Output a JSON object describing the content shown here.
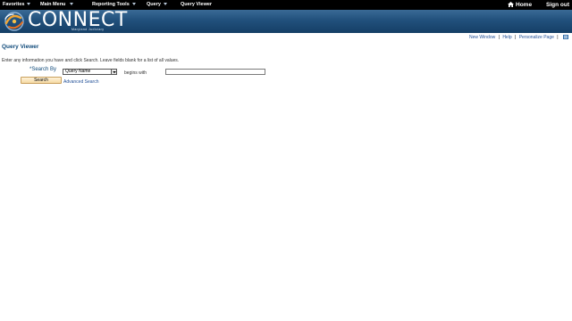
{
  "nav": {
    "items": [
      {
        "label": "Favorites",
        "has_dropdown": true
      },
      {
        "label": "Main Menu",
        "has_dropdown": true
      },
      {
        "label": "Reporting Tools",
        "has_dropdown": true
      },
      {
        "label": "Query",
        "has_dropdown": true
      },
      {
        "label": "Query Viewer",
        "has_dropdown": false
      }
    ],
    "home_label": "Home",
    "signout_label": "Sign out",
    "home_icon": "home-icon",
    "dropdown_icon": "caret-down-icon"
  },
  "banner": {
    "logo_text": "CONNECT",
    "logo_subtext": "Maryland Judiciary",
    "logo_icon": "swirl-logo-icon"
  },
  "pagelinks": {
    "new_window": "New Window",
    "help": "Help",
    "personalize": "Personalize Page",
    "separator": "|",
    "grid_icon": "grid-icon"
  },
  "main": {
    "title": "Query Viewer",
    "instructions": "Enter any information you have and click Search. Leave fields blank for a list of all values.",
    "search_by_label": "*Search By",
    "search_by_value": "Query Name",
    "operator_label": "begins with",
    "search_value": "",
    "search_button": "Search",
    "advanced_search": "Advanced Search"
  },
  "colors": {
    "nav_bg": "#000000",
    "banner_top": "#3a6a95",
    "banner_bottom": "#153f66",
    "link": "#1f4e96",
    "title": "#0f4a7a",
    "button_bg": "#f5d9a4"
  }
}
